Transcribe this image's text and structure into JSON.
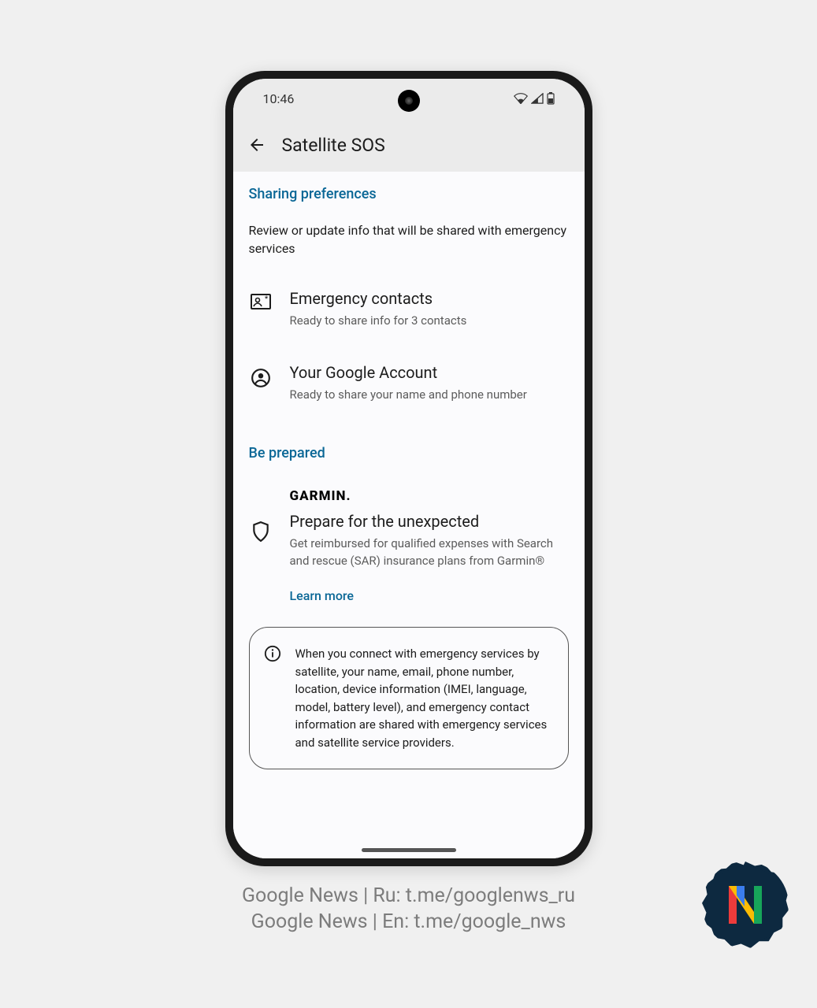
{
  "statusbar": {
    "time": "10:46"
  },
  "header": {
    "title": "Satellite SOS"
  },
  "sections": {
    "sharing": {
      "header": "Sharing preferences",
      "desc": "Review or update info that will be shared with emergency services",
      "contacts": {
        "title": "Emergency contacts",
        "sub": "Ready to share info for 3 contacts"
      },
      "account": {
        "title": "Your Google Account",
        "sub": "Ready to share your name and phone number"
      }
    },
    "prepared": {
      "header": "Be prepared",
      "garmin_logo": "GARMIN.",
      "title": "Prepare for the unexpected",
      "sub": "Get reimbursed for qualified expenses with Search and rescue (SAR) insurance plans from Garmin®",
      "learn_more": "Learn more"
    },
    "info": {
      "text": "When you connect with emergency services by satellite, your name, email, phone number, location, device information (IMEI, language, model, battery level), and emergency contact information are shared with emergency services and satellite service providers."
    }
  },
  "caption": {
    "line1": "Google News | Ru: t.me/googlenws_ru",
    "line2": "Google News | En: t.me/google_nws"
  }
}
